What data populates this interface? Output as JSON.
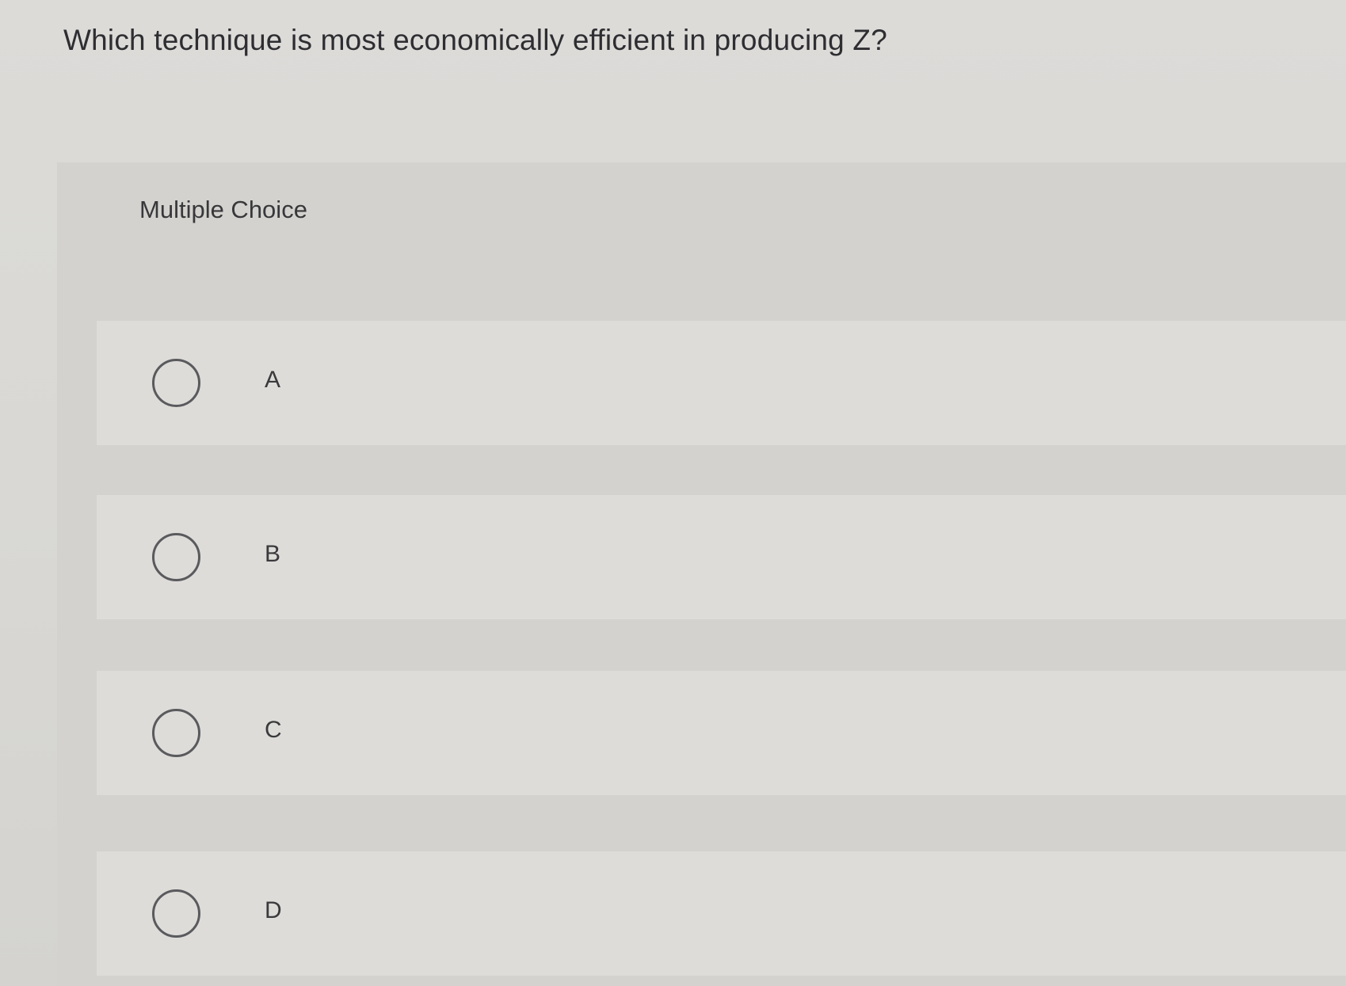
{
  "question": {
    "text": "Which technique is most economically efficient in producing Z?"
  },
  "panel": {
    "label": "Multiple Choice"
  },
  "options": [
    {
      "label": "A"
    },
    {
      "label": "B"
    },
    {
      "label": "C"
    },
    {
      "label": "D"
    }
  ],
  "colors": {
    "background": "#dcdbd8",
    "panel": "#d3d2ce",
    "option_row": "#dddcd8",
    "radio_border": "#5a5a5e",
    "text": "#2e2e32"
  }
}
